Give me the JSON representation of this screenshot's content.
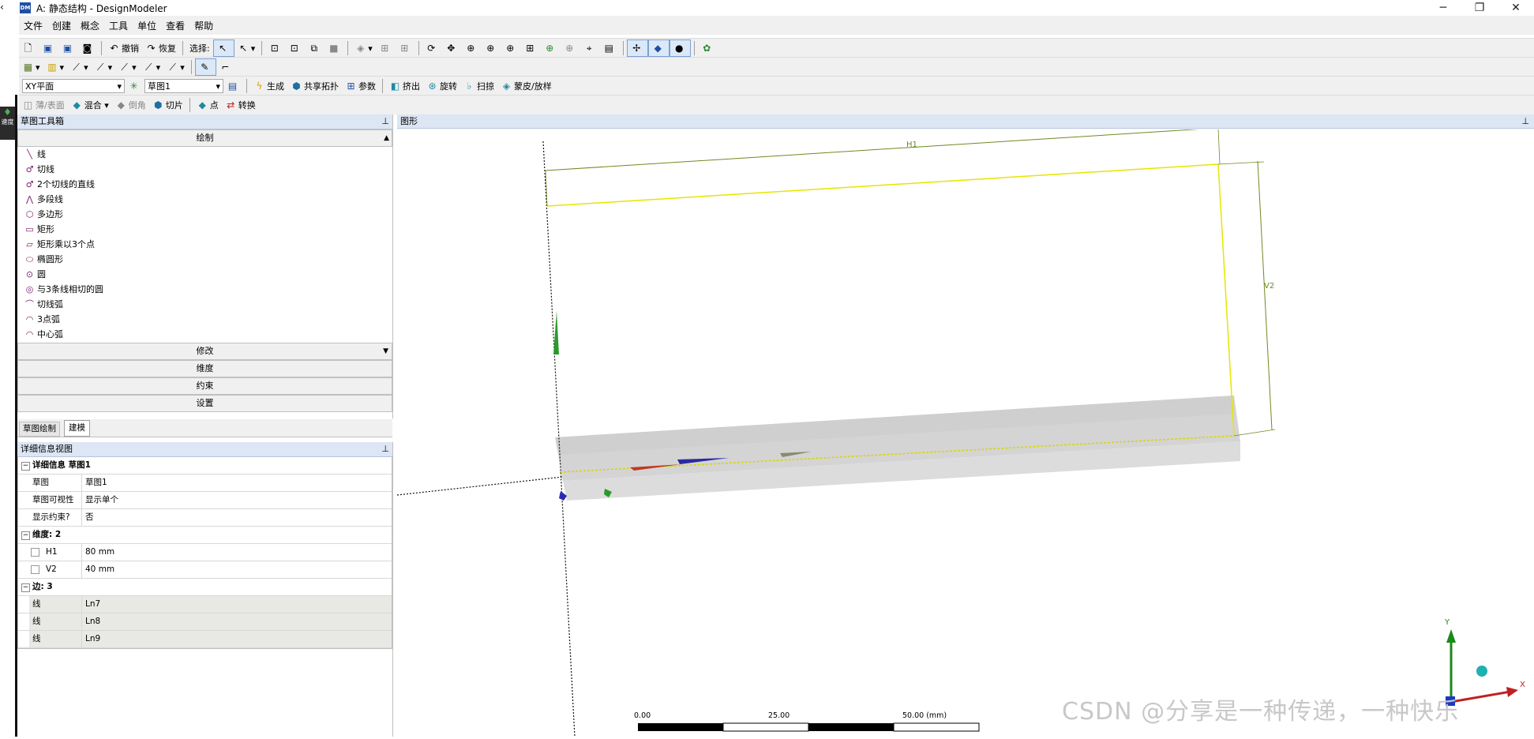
{
  "window": {
    "app_icon_text": "DM",
    "title": "A: 静态结构 - DesignModeler",
    "minimize_glyph": "─",
    "maximize_glyph": "❐",
    "close_glyph": "✕"
  },
  "side_tab": {
    "label": "速度"
  },
  "menubar": [
    "文件",
    "创建",
    "概念",
    "工具",
    "单位",
    "查看",
    "帮助"
  ],
  "toolbar1": {
    "undo_label": "撤销",
    "redo_label": "恢复",
    "select_label": "选择:"
  },
  "toolbar3": {
    "plane_select": "XY平面",
    "sketch_select": "草图1",
    "generate_label": "生成",
    "share_topology_label": "共享拓扑",
    "parameters_label": "参数",
    "extrude_label": "挤出",
    "revolve_label": "旋转",
    "sweep_label": "扫掠",
    "skin_loft_label": "蒙皮/放样"
  },
  "toolbar4": {
    "thin_surface_label": "薄/表面",
    "blend_label": "混合",
    "chamfer_label": "倒角",
    "slice_label": "切片",
    "point_label": "点",
    "convert_label": "转换"
  },
  "sketch_toolbox": {
    "title": "草图工具箱",
    "draw_header": "绘制",
    "draw_items": [
      {
        "label": "线",
        "icon": "line-icon",
        "glyph": "╲"
      },
      {
        "label": "切线",
        "icon": "tangent-line-icon",
        "glyph": "♂"
      },
      {
        "label": "2个切线的直线",
        "icon": "two-tangent-line-icon",
        "glyph": "♂"
      },
      {
        "label": "多段线",
        "icon": "polyline-icon",
        "glyph": "⋀"
      },
      {
        "label": "多边形",
        "icon": "polygon-icon",
        "glyph": "⬡"
      },
      {
        "label": "矩形",
        "icon": "rectangle-icon",
        "glyph": "▭"
      },
      {
        "label": "矩形乘以3个点",
        "icon": "rectangle-3pt-icon",
        "glyph": "▱"
      },
      {
        "label": "椭圆形",
        "icon": "oval-icon",
        "glyph": "⬭"
      },
      {
        "label": "圆",
        "icon": "circle-icon",
        "glyph": "⊙"
      },
      {
        "label": "与3条线相切的圆",
        "icon": "circle-3tangent-icon",
        "glyph": "◎"
      },
      {
        "label": "切线弧",
        "icon": "tangent-arc-icon",
        "glyph": "⌒"
      },
      {
        "label": "3点弧",
        "icon": "three-point-arc-icon",
        "glyph": "◠"
      },
      {
        "label": "中心弧",
        "icon": "center-arc-icon",
        "glyph": "◠"
      }
    ],
    "sections": [
      "修改",
      "维度",
      "约束",
      "设置"
    ]
  },
  "tabs": {
    "sketching": "草图绘制",
    "modeling": "建模"
  },
  "details": {
    "title": "详细信息视图",
    "group1": "详细信息 草图1",
    "rows1": [
      {
        "k": "草图",
        "v": "草图1"
      },
      {
        "k": "草图可视性",
        "v": "显示单个"
      },
      {
        "k": "显示约束?",
        "v": "否"
      }
    ],
    "group2": "维度: 2",
    "dims": [
      {
        "k": "H1",
        "v": "80 mm"
      },
      {
        "k": "V2",
        "v": "40 mm"
      }
    ],
    "group3": "边: 3",
    "edges": [
      {
        "k": "线",
        "v": "Ln7"
      },
      {
        "k": "线",
        "v": "Ln8"
      },
      {
        "k": "线",
        "v": "Ln9"
      }
    ]
  },
  "graphics": {
    "title": "图形",
    "dim_h": "H1",
    "dim_v": "V2",
    "scale_ticks": [
      "0.00",
      "25.00",
      "50.00 (mm)"
    ],
    "triad_x": "X",
    "triad_y": "Y",
    "pin_glyph": "⊕"
  },
  "watermark": "CSDN @分享是一种传递，一种快乐"
}
